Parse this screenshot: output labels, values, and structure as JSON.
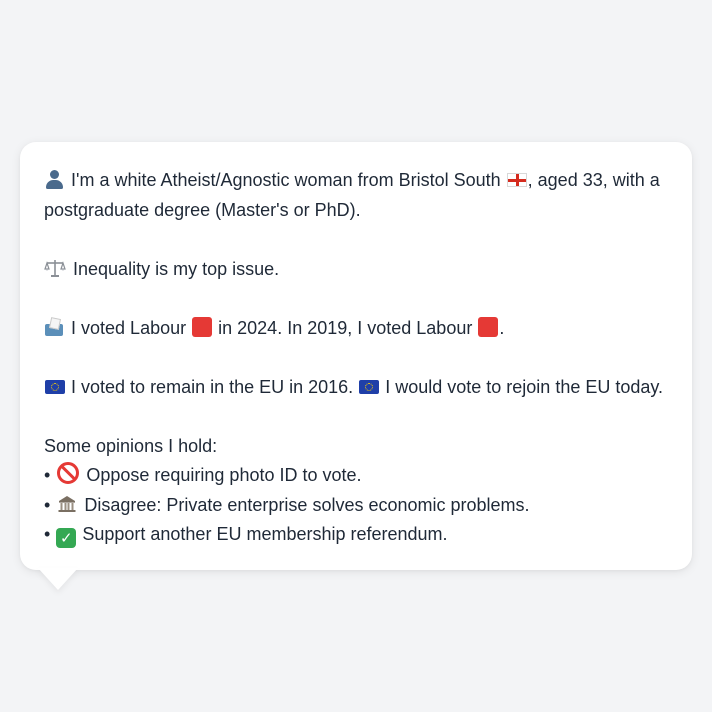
{
  "profile": {
    "intro_pre": "I'm a white Atheist/Agnostic woman from Bristol South",
    "intro_post": ", aged 33, with a postgraduate degree (Master's or PhD).",
    "top_issue": "Inequality is my top issue.",
    "vote_pre": "I voted Labour",
    "vote_mid": "in 2024. In 2019, I voted Labour",
    "vote_end": ".",
    "eu_1": "I voted to remain in the EU in 2016.",
    "eu_2": "I would vote to rejoin the EU today.",
    "opinions_heading": "Some opinions I hold:",
    "opinions": [
      {
        "bullet": "•",
        "icon": "prohibited-icon",
        "text": "Oppose requiring photo ID to vote."
      },
      {
        "bullet": "•",
        "icon": "bank-icon",
        "text": "Disagree: Private enterprise solves economic problems."
      },
      {
        "bullet": "•",
        "icon": "check-mark-icon",
        "text": "Support another EU membership referendum."
      }
    ]
  },
  "colors": {
    "background": "#f3f4f6",
    "bubble": "#ffffff",
    "text": "#1f2937",
    "labour_red": "#e53935",
    "eu_blue": "#1f3fa8",
    "check_green": "#34a853"
  }
}
